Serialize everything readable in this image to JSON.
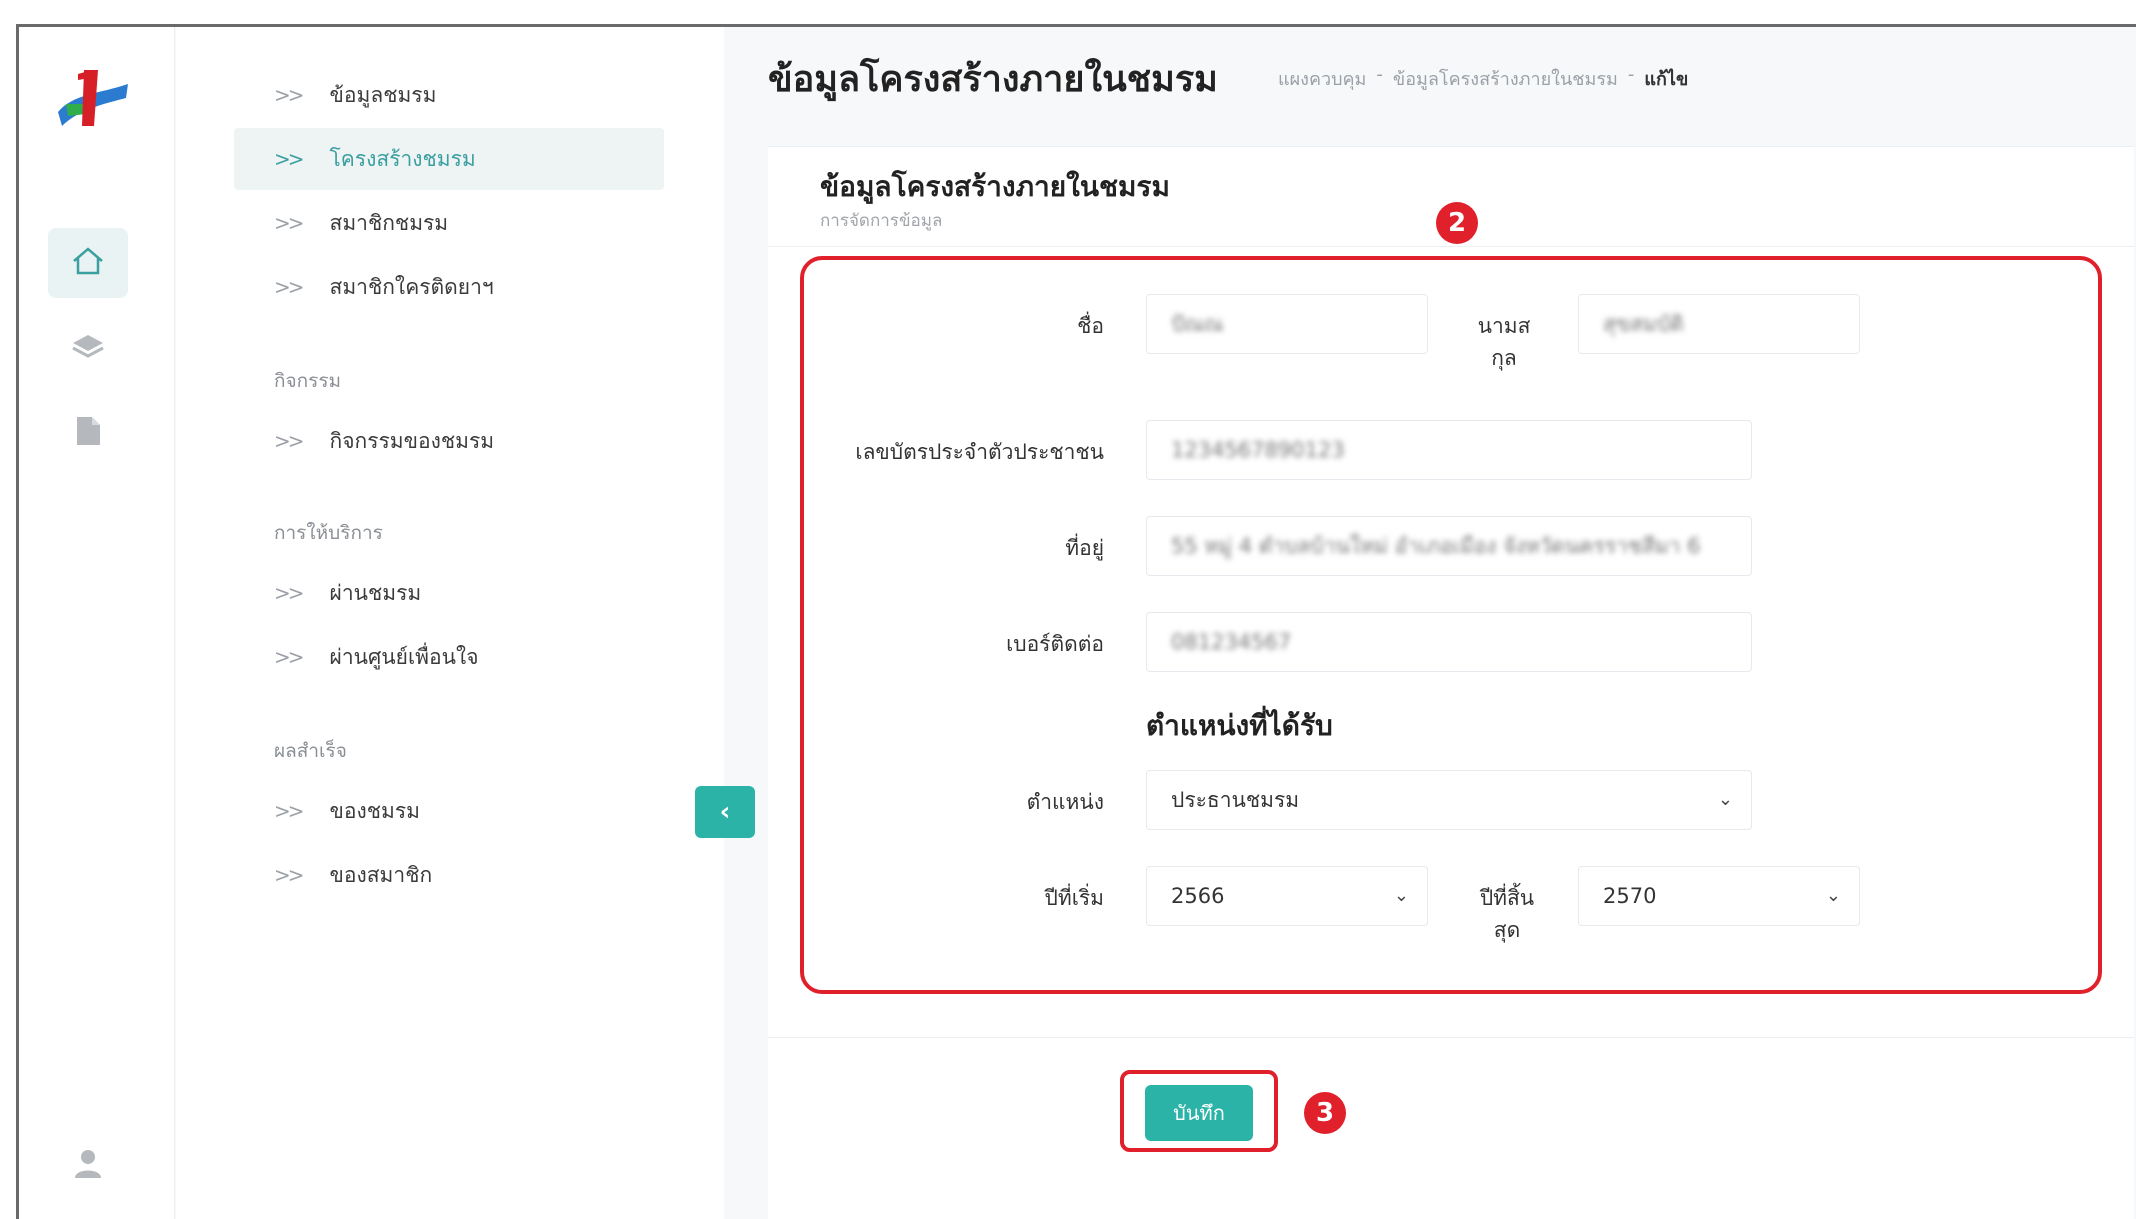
{
  "sidebar": {
    "items": [
      {
        "label": "ข้อมูลชมรม"
      },
      {
        "label": "โครงสร้างชมรม"
      },
      {
        "label": "สมาชิกชมรม"
      },
      {
        "label": "สมาชิกใครติดยาฯ"
      }
    ],
    "sections": [
      {
        "title": "กิจกรรม",
        "items": [
          {
            "label": "กิจกรรมของชมรม"
          }
        ]
      },
      {
        "title": "การให้บริการ",
        "items": [
          {
            "label": "ผ่านชมรม"
          },
          {
            "label": "ผ่านศูนย์เพื่อนใจ"
          }
        ]
      },
      {
        "title": "ผลสำเร็จ",
        "items": [
          {
            "label": "ของชมรม"
          },
          {
            "label": "ของสมาชิก"
          }
        ]
      }
    ],
    "chevron": ">>",
    "collapse": "‹"
  },
  "header": {
    "title": "ข้อมูลโครงสร้างภายในชมรม",
    "breadcrumb": [
      "แผงควบคุม",
      "ข้อมูลโครงสร้างภายในชมรม",
      "แก้ไข"
    ],
    "separator": "-"
  },
  "card": {
    "title": "ข้อมูลโครงสร้างภายในชมรม",
    "subtitle": "การจัดการข้อมูล"
  },
  "form": {
    "first_name_label": "ชื่อ",
    "first_name_value": "ปัณณ",
    "last_name_label_1": "นามส",
    "last_name_label_2": "กุล",
    "last_name_value": "สุขสมบัติ",
    "id_label": "เลขบัตรประจำตัวประชาชน",
    "id_value": "1234567890123",
    "address_label": "ที่อยู่",
    "address_value": "55 หมู่ 4 ตำบลบ้านใหม่ อำเภอเมือง จังหวัดนครราชสีมา 6",
    "phone_label": "เบอร์ติดต่อ",
    "phone_value": "081234567",
    "position_heading": "ตำแหน่งที่ได้รับ",
    "position_label": "ตำแหน่ง",
    "position_value": "ประธานชมรม",
    "start_year_label": "ปีที่เริ่ม",
    "start_year_value": "2566",
    "end_year_label_1": "ปีที่สิ้น",
    "end_year_label_2": "สุด",
    "end_year_value": "2570"
  },
  "actions": {
    "save_label": "บันทึก"
  },
  "annotations": {
    "box_2": "2",
    "box_3": "3"
  },
  "colors": {
    "accent": "#2bb3a8",
    "annotation": "#e0202a"
  },
  "icons": [
    "logo-icon",
    "home-icon",
    "layers-icon",
    "document-icon",
    "user-icon",
    "chevron-down-icon"
  ]
}
